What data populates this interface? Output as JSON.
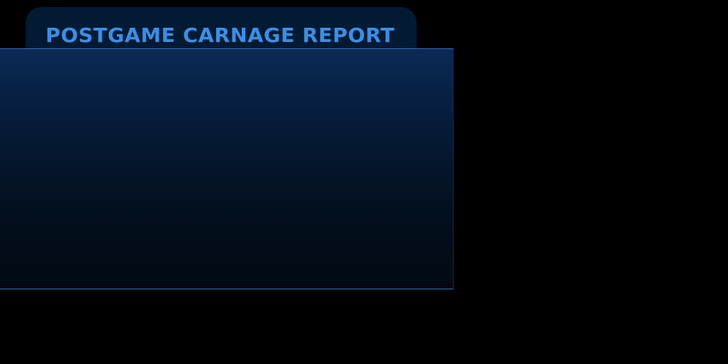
{
  "screen": {
    "title": "POSTGAME CARNAGE REPORT"
  },
  "colors": {
    "title_text": "#3a8fe6",
    "tab_background": "#031a33",
    "panel_top": "#0a2a55",
    "panel_bottom": "#020912",
    "panel_border": "#3b6fb8",
    "background": "#000000"
  }
}
